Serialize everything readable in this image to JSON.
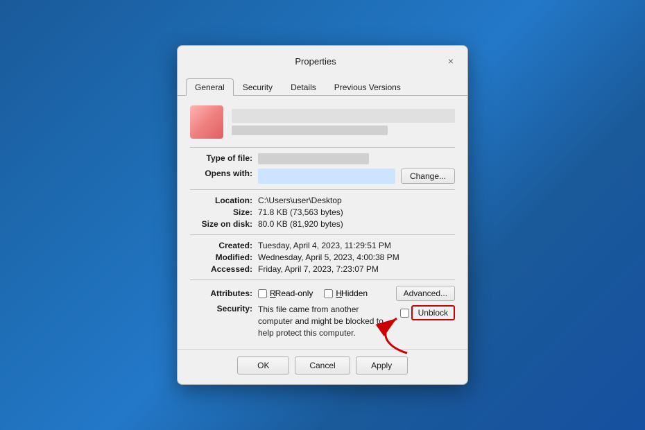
{
  "dialog": {
    "title": "Properties",
    "close_label": "×"
  },
  "tabs": [
    {
      "id": "general",
      "label": "General",
      "active": true
    },
    {
      "id": "security",
      "label": "Security",
      "active": false
    },
    {
      "id": "details",
      "label": "Details",
      "active": false
    },
    {
      "id": "previous_versions",
      "label": "Previous Versions",
      "active": false
    }
  ],
  "general": {
    "type_of_file_label": "Type of file:",
    "opens_with_label": "Opens with:",
    "change_button_label": "Change...",
    "location_label": "Location:",
    "location_value": "C:\\Users\\user\\Desktop",
    "size_label": "Size:",
    "size_value": "71.8 KB (73,563 bytes)",
    "size_on_disk_label": "Size on disk:",
    "size_on_disk_value": "80.0 KB (81,920 bytes)",
    "created_label": "Created:",
    "created_value": "Tuesday, April 4, 2023, 11:29:51 PM",
    "modified_label": "Modified:",
    "modified_value": "Wednesday, April 5, 2023, 4:00:38 PM",
    "accessed_label": "Accessed:",
    "accessed_value": "Friday, April 7, 2023, 7:23:07 PM",
    "attributes_label": "Attributes:",
    "readonly_label": "Read-only",
    "hidden_label": "Hidden",
    "advanced_button_label": "Advanced...",
    "security_label": "Security:",
    "security_text": "This file came from another computer and might be blocked to help protect this computer.",
    "unblock_label": "Unblock"
  },
  "bottom_buttons": {
    "ok_label": "OK",
    "cancel_label": "Cancel",
    "apply_label": "Apply"
  }
}
